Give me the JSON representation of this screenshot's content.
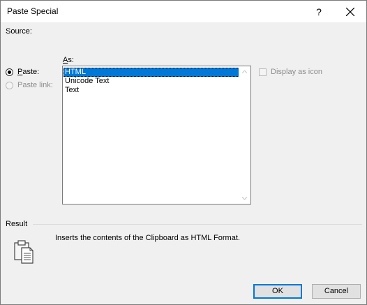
{
  "window": {
    "title": "Paste Special",
    "help_label": "?"
  },
  "source": {
    "label": "Source:"
  },
  "as_label": {
    "prefix": "A",
    "rest": "s:"
  },
  "paste_options": [
    {
      "label_prefix": "P",
      "label_rest": "aste:",
      "checked": true,
      "enabled": true
    },
    {
      "label_prefix": "",
      "label_rest": "Paste link:",
      "checked": false,
      "enabled": false
    }
  ],
  "formats": {
    "items": [
      "HTML",
      "Unicode Text",
      "Text"
    ],
    "selected_index": 0
  },
  "display_as_icon": {
    "label": "Display as icon",
    "checked": false,
    "enabled": false
  },
  "result": {
    "label": "Result",
    "description": "Inserts the contents of the Clipboard as HTML Format."
  },
  "buttons": {
    "ok": "OK",
    "cancel": "Cancel"
  },
  "colors": {
    "selection": "#0078d7",
    "dialog_bg": "#f0f0f0"
  }
}
